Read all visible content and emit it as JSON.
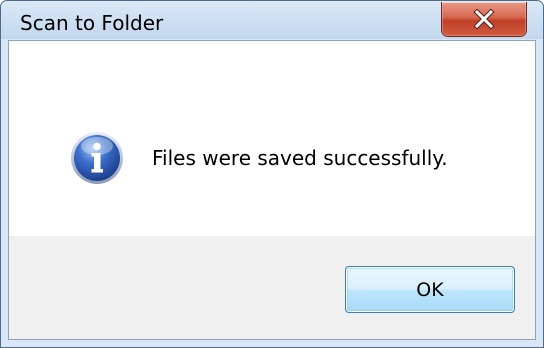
{
  "window": {
    "title": "Scan to Folder",
    "close_icon": "close-icon"
  },
  "dialog": {
    "icon": "info-icon",
    "message": "Files were saved successfully.",
    "ok_label": "OK"
  },
  "colors": {
    "titlebar": "#cddff2",
    "close_button": "#c0402a",
    "content_background": "#f0f0f0",
    "message_background": "#ffffff",
    "ok_button_border": "#3c7fb1",
    "info_icon_blue": "#2f5fb8"
  }
}
